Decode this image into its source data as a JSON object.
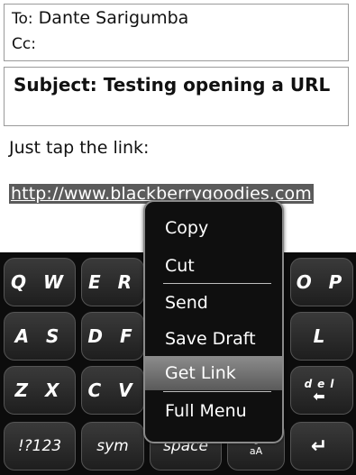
{
  "header": {
    "to_label": "To:",
    "to_value": "Dante Sarigumba",
    "cc_label": "Cc:",
    "subject": "Subject: Testing opening a URL"
  },
  "body": {
    "line1": "Just tap the link:",
    "url": "http://www.blackberrygoodies.com"
  },
  "context_menu": {
    "items": [
      "Copy",
      "Cut",
      "Send",
      "Save Draft",
      "Get Link",
      "Full Menu"
    ],
    "selected": "Get Link"
  },
  "keyboard": {
    "row1": [
      "Q W",
      "E R",
      "O P"
    ],
    "row2": [
      "A S",
      "D F",
      "L"
    ],
    "row3": [
      "Z X",
      "C V",
      "del"
    ],
    "row4": [
      "!?123",
      "sym",
      "space",
      "aA"
    ],
    "enter_icon": "enter-icon",
    "backspace_icon": "backspace-arrow-icon"
  }
}
